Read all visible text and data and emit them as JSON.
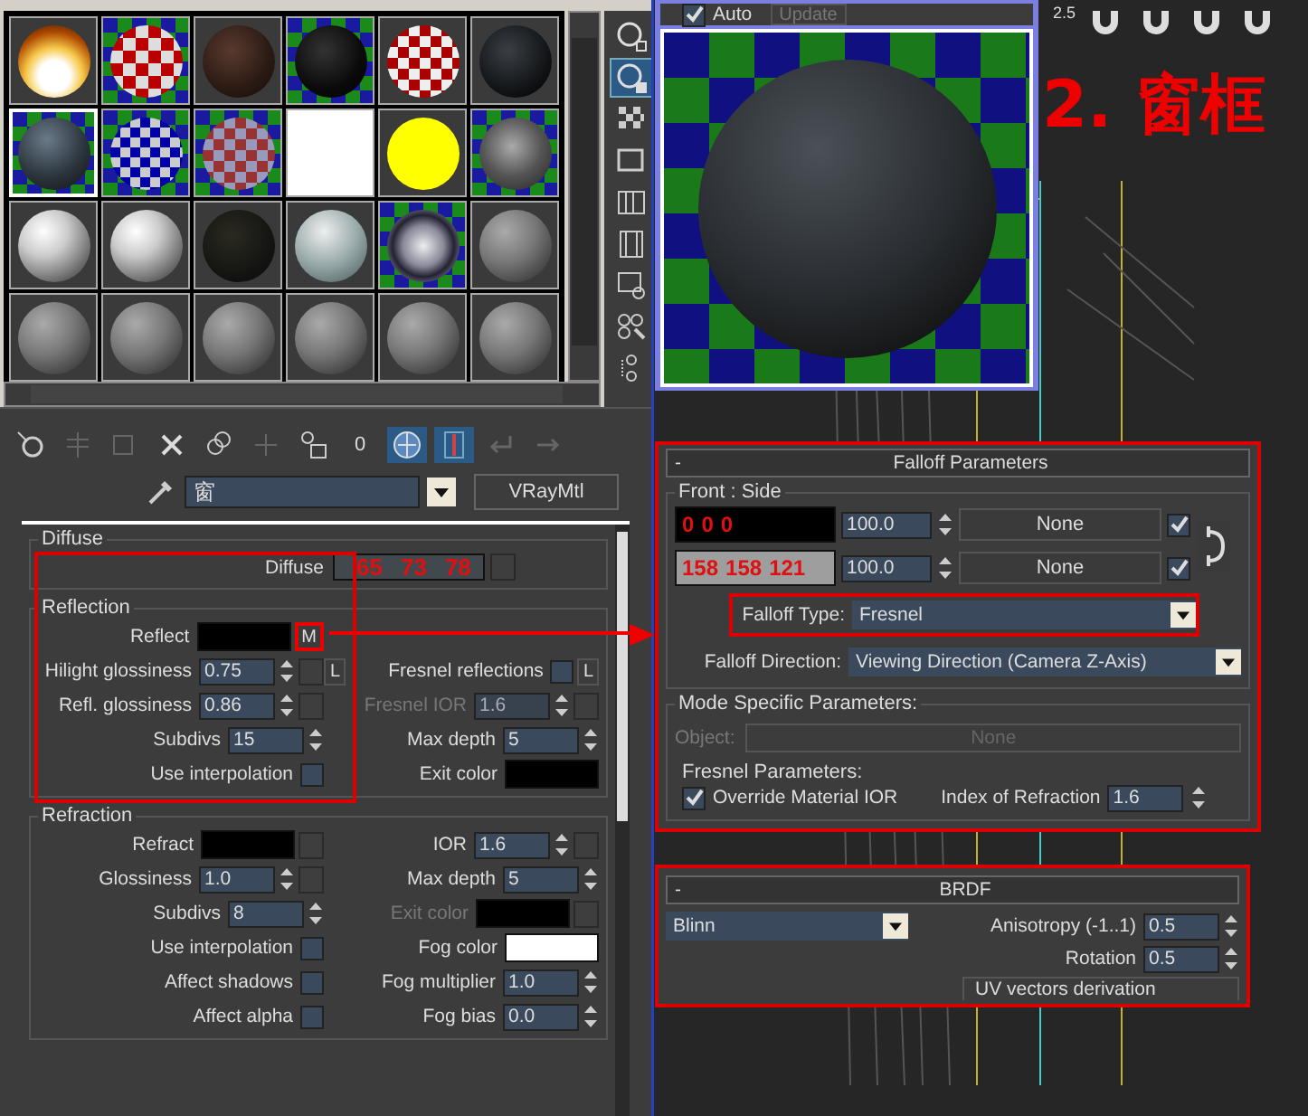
{
  "sample_slots": [
    {
      "kind": "fire",
      "selected": false
    },
    {
      "kind": "checker",
      "selected": false
    },
    {
      "kind": "brown",
      "selected": false
    },
    {
      "kind": "blackcheck",
      "selected": false
    },
    {
      "kind": "redcheck",
      "selected": false
    },
    {
      "kind": "glass",
      "selected": false
    },
    {
      "kind": "bluegray",
      "selected": true
    },
    {
      "kind": "mirror",
      "selected": false
    },
    {
      "kind": "glassball",
      "selected": false
    },
    {
      "kind": "white",
      "selected": false
    },
    {
      "kind": "yellow",
      "selected": false
    },
    {
      "kind": "speckled",
      "selected": false
    },
    {
      "kind": "whitegloss",
      "selected": false
    },
    {
      "kind": "whitegloss",
      "selected": false
    },
    {
      "kind": "black",
      "selected": false
    },
    {
      "kind": "silver",
      "selected": false
    },
    {
      "kind": "chrome",
      "selected": false
    },
    {
      "kind": "gray",
      "selected": false
    },
    {
      "kind": "gray",
      "selected": false
    },
    {
      "kind": "gray",
      "selected": false
    },
    {
      "kind": "gray",
      "selected": false
    },
    {
      "kind": "gray",
      "selected": false
    },
    {
      "kind": "gray",
      "selected": false
    },
    {
      "kind": "gray",
      "selected": false
    }
  ],
  "side_toolbar": [
    {
      "kind": "sample-type",
      "selected": false
    },
    {
      "kind": "backlight",
      "selected": true
    },
    {
      "kind": "background",
      "selected": false
    },
    {
      "kind": "tiling",
      "selected": false
    },
    {
      "kind": "video",
      "selected": false
    },
    {
      "kind": "movie",
      "selected": false
    },
    {
      "kind": "options",
      "selected": false
    },
    {
      "kind": "select-by",
      "selected": false
    },
    {
      "kind": "navigator",
      "selected": false
    }
  ],
  "toolbar": [
    {
      "kind": "get",
      "selected": false
    },
    {
      "kind": "put",
      "selected": false
    },
    {
      "kind": "assign",
      "selected": false
    },
    {
      "kind": "reset",
      "selected": false
    },
    {
      "kind": "copy",
      "selected": false
    },
    {
      "kind": "unique",
      "selected": false
    },
    {
      "kind": "library",
      "selected": false
    },
    {
      "kind": "effects-id",
      "label": "0",
      "selected": false
    },
    {
      "kind": "show-map",
      "selected": true
    },
    {
      "kind": "show-end",
      "selected": true
    },
    {
      "kind": "parent",
      "selected": false
    },
    {
      "kind": "sibling",
      "selected": false
    }
  ],
  "material": {
    "name": "窗",
    "type": "VRayMtl"
  },
  "diffuse": {
    "title": "Diffuse",
    "label": "Diffuse",
    "color": "#41494e",
    "annotation": [
      "65",
      "73",
      "78"
    ]
  },
  "reflection": {
    "title": "Reflection",
    "left": [
      {
        "kind": "color",
        "label": "Reflect",
        "color": "#000000",
        "map": "M"
      },
      {
        "kind": "spinner",
        "label": "Hilight glossiness",
        "value": "0.75",
        "slot": true,
        "lock": "L"
      },
      {
        "kind": "spinner",
        "label": "Refl. glossiness",
        "value": "0.86",
        "slot": true
      },
      {
        "kind": "spinner",
        "label": "Subdivs",
        "value": "15"
      },
      {
        "kind": "check",
        "label": "Use interpolation",
        "checked": false
      }
    ],
    "right": [
      {
        "kind": "check",
        "label": "Fresnel reflections",
        "checked": false,
        "lock": "L"
      },
      {
        "kind": "spinner",
        "label": "Fresnel IOR",
        "value": "1.6",
        "slot": true,
        "disabled": true
      },
      {
        "kind": "spinner",
        "label": "Max depth",
        "value": "5"
      },
      {
        "kind": "color",
        "label": "Exit color",
        "color": "#000000"
      }
    ]
  },
  "refraction": {
    "title": "Refraction",
    "left": [
      {
        "kind": "color",
        "label": "Refract",
        "color": "#000000",
        "slot": true
      },
      {
        "kind": "spinner",
        "label": "Glossiness",
        "value": "1.0",
        "slot": true
      },
      {
        "kind": "spinner",
        "label": "Subdivs",
        "value": "8"
      },
      {
        "kind": "check",
        "label": "Use interpolation",
        "checked": false
      },
      {
        "kind": "check",
        "label": "Affect shadows",
        "checked": false
      },
      {
        "kind": "check",
        "label": "Affect alpha",
        "checked": false
      }
    ],
    "right": [
      {
        "kind": "spinner",
        "label": "IOR",
        "value": "1.6",
        "slot": true
      },
      {
        "kind": "spinner",
        "label": "Max depth",
        "value": "5"
      },
      {
        "kind": "color",
        "label": "Exit color",
        "color": "#000000",
        "slot": true,
        "disabled": true
      },
      {
        "kind": "color",
        "label": "Fog color",
        "color": "#ffffff"
      },
      {
        "kind": "spinner",
        "label": "Fog multiplier",
        "value": "1.0"
      },
      {
        "kind": "spinner",
        "label": "Fog bias",
        "value": "0.0"
      }
    ]
  },
  "preview": {
    "auto": {
      "label": "Auto",
      "checked": true
    },
    "update": {
      "label": "Update",
      "disabled": true
    }
  },
  "viewport": {
    "snap_label": "2.5",
    "annotation": "2. 窗框"
  },
  "falloff": {
    "title": "Falloff Parameters",
    "collapse": "-",
    "group_title": "Front : Side",
    "rows": [
      {
        "color": "#000000",
        "annotation": [
          "0",
          "0",
          "0"
        ],
        "value": "100.0",
        "map": "None",
        "checked": true
      },
      {
        "color": "#9e9e9e",
        "annotation": [
          "158",
          "158",
          "121"
        ],
        "value": "100.0",
        "map": "None",
        "checked": true
      }
    ],
    "falloff_type": {
      "label": "Falloff Type:",
      "value": "Fresnel"
    },
    "falloff_direction": {
      "label": "Falloff Direction:",
      "value": "Viewing Direction (Camera Z-Axis)"
    },
    "mode": {
      "title": "Mode Specific Parameters:",
      "object_label": "Object:",
      "object_value": "None",
      "disabled": true
    },
    "fresnel": {
      "title": "Fresnel Parameters:",
      "override_label": "Override Material IOR",
      "override_checked": true,
      "ior_label": "Index of Refraction",
      "ior_value": "1.6"
    }
  },
  "brdf": {
    "title": "BRDF",
    "collapse": "-",
    "type": "Blinn",
    "anisotropy": {
      "label": "Anisotropy (-1..1)",
      "value": "0.5"
    },
    "rotation": {
      "label": "Rotation",
      "value": "0.5"
    },
    "uv_title": "UV vectors derivation"
  }
}
